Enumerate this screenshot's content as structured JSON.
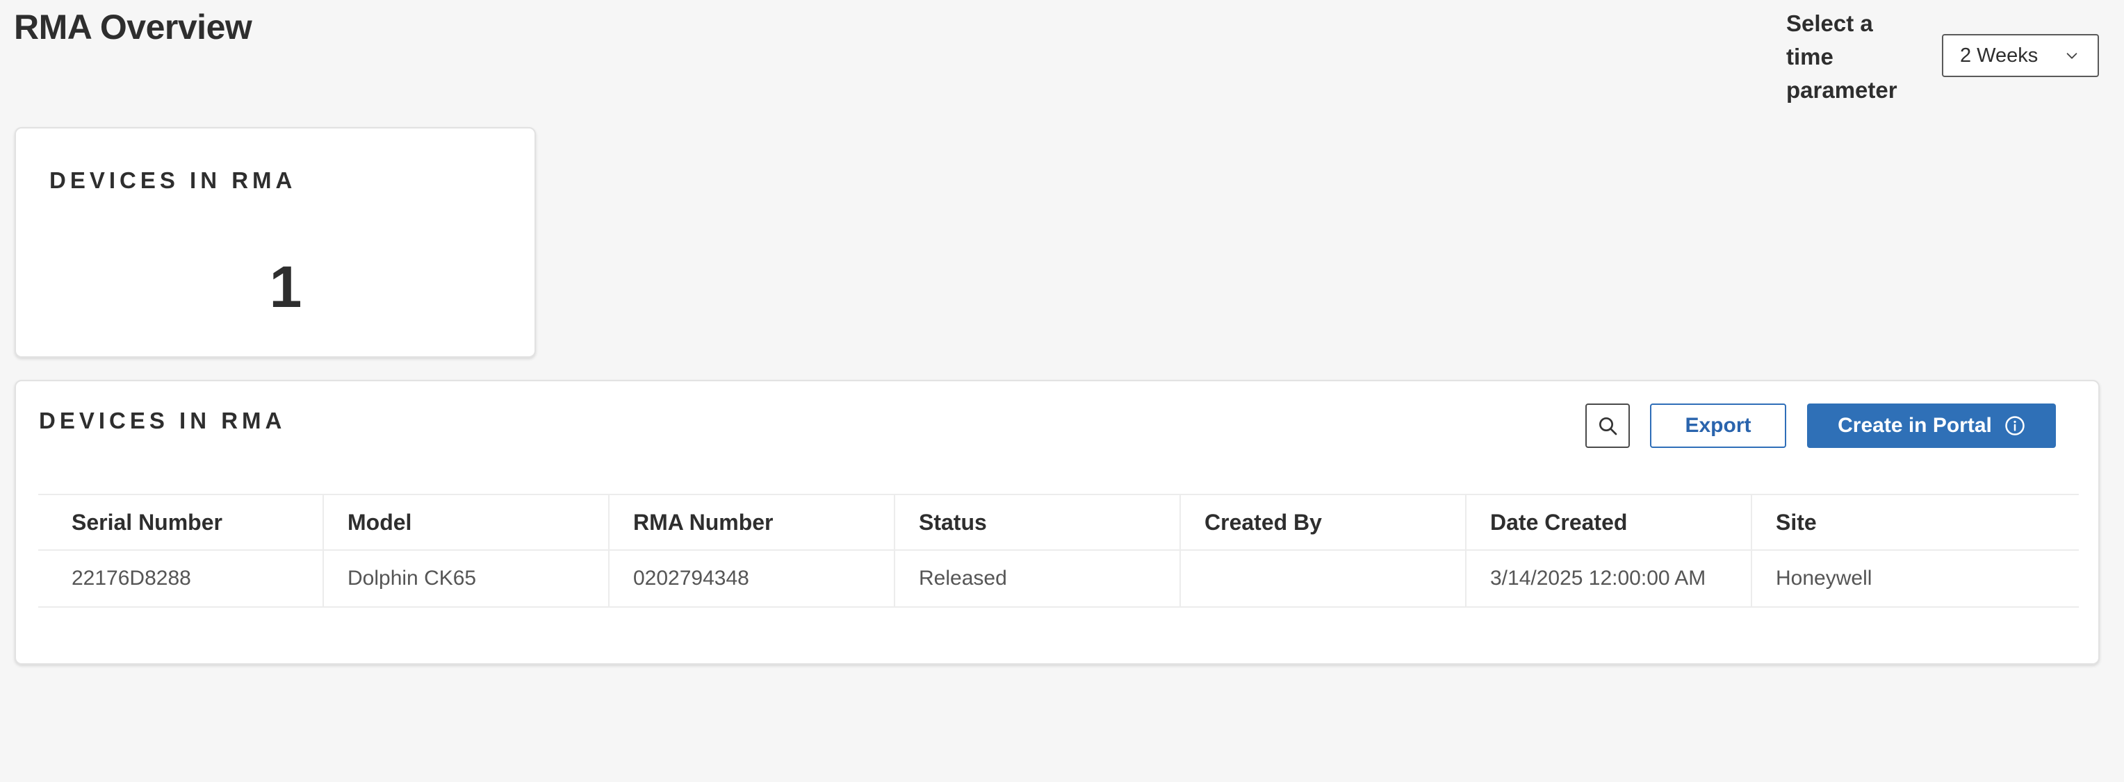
{
  "page": {
    "title": "RMA Overview"
  },
  "time_filter": {
    "label": "Select a time parameter",
    "selected": "2 Weeks",
    "icon": "chevron-down-icon"
  },
  "kpi": {
    "title": "DEVICES IN RMA",
    "value": "1"
  },
  "table": {
    "title": "DEVICES IN RMA",
    "search_icon": "search-icon",
    "export_label": "Export",
    "create_label": "Create in Portal",
    "create_icon": "info-icon",
    "columns": [
      "Serial Number",
      "Model",
      "RMA Number",
      "Status",
      "Created By",
      "Date Created",
      "Site"
    ],
    "rows": [
      [
        "22176D8288",
        "Dolphin CK65",
        "0202794348",
        "Released",
        "",
        "3/14/2025 12:00:00 AM",
        "Honeywell"
      ]
    ]
  },
  "colors": {
    "primary": "#2f70b7",
    "background": "#f6f6f6"
  }
}
